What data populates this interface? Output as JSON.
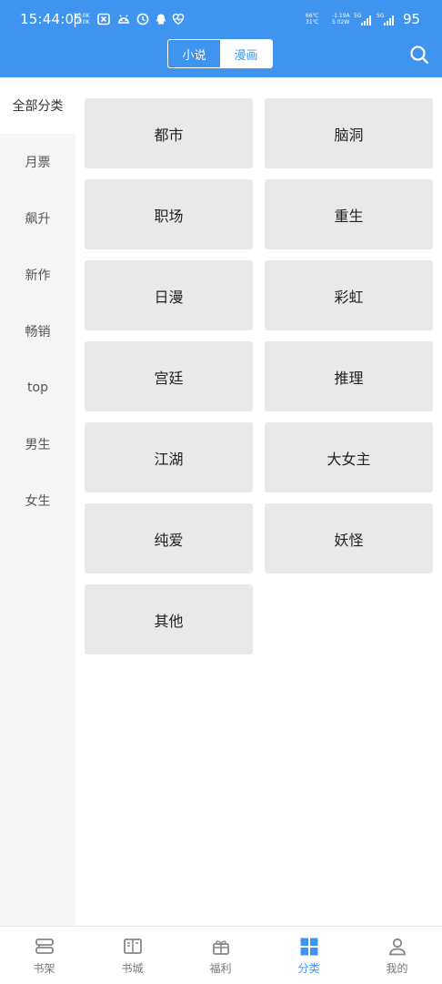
{
  "status_bar": {
    "time": "15:44:05",
    "separator": "|",
    "net_speed": [
      "0.0K",
      "0.0K"
    ],
    "temps": [
      "66℃",
      "31℃"
    ],
    "power": [
      "-1.19A",
      "5.02W"
    ],
    "signal_labels": [
      "5G",
      "5G"
    ],
    "battery": "95",
    "icons": [
      "close-box-icon",
      "android-icon",
      "clock-icon",
      "qq-icon",
      "heart-rate-icon"
    ]
  },
  "header": {
    "tabs": [
      {
        "label": "小说",
        "active": false
      },
      {
        "label": "漫画",
        "active": true
      }
    ],
    "search_icon": "search-icon"
  },
  "sidebar": {
    "items": [
      {
        "label": "全部分类",
        "active": true
      },
      {
        "label": "月票",
        "active": false
      },
      {
        "label": "飙升",
        "active": false
      },
      {
        "label": "新作",
        "active": false
      },
      {
        "label": "畅销",
        "active": false
      },
      {
        "label": "top",
        "active": false
      },
      {
        "label": "男生",
        "active": false
      },
      {
        "label": "女生",
        "active": false
      }
    ]
  },
  "categories": [
    "都市",
    "脑洞",
    "职场",
    "重生",
    "日漫",
    "彩虹",
    "宫廷",
    "推理",
    "江湖",
    "大女主",
    "纯爱",
    "妖怪",
    "其他"
  ],
  "bottom_nav": {
    "items": [
      {
        "label": "书架",
        "icon": "bookshelf-icon",
        "active": false
      },
      {
        "label": "书城",
        "icon": "book-open-icon",
        "active": false
      },
      {
        "label": "福利",
        "icon": "gift-icon",
        "active": false
      },
      {
        "label": "分类",
        "icon": "grid-icon",
        "active": true
      },
      {
        "label": "我的",
        "icon": "user-icon",
        "active": false
      }
    ]
  },
  "colors": {
    "accent": "#3e94ee",
    "cell_bg": "#e9e9e9",
    "sidebar_bg": "#f6f6f6"
  }
}
